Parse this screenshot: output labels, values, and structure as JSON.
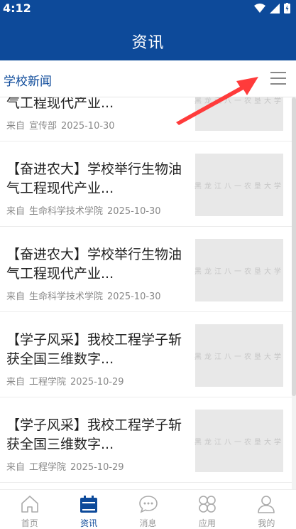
{
  "status": {
    "time": "4:12"
  },
  "header": {
    "title": "资讯"
  },
  "section": {
    "title": "学校新闻"
  },
  "news": [
    {
      "title": "【奋进农大】学校举行生物油气工程现代产业...",
      "source_prefix": "来自",
      "source": "宣传部",
      "date": "2025-10-30"
    },
    {
      "title": "【奋进农大】学校举行生物油气工程现代产业...",
      "source_prefix": "来自",
      "source": "生命科学技术学院",
      "date": "2025-10-30"
    },
    {
      "title": "【奋进农大】学校举行生物油气工程现代产业...",
      "source_prefix": "来自",
      "source": "生命科学技术学院",
      "date": "2025-10-30"
    },
    {
      "title": "【学子风采】我校工程学子斩获全国三维数字...",
      "source_prefix": "来自",
      "source": "工程学院",
      "date": "2025-10-29"
    },
    {
      "title": "【学子风采】我校工程学子斩获全国三维数字...",
      "source_prefix": "来自",
      "source": "工程学院",
      "date": "2025-10-29"
    }
  ],
  "thumb_watermark": "黑龙江八一农垦大学",
  "nav": [
    {
      "label": "首页",
      "icon": "home-icon"
    },
    {
      "label": "资讯",
      "icon": "calendar-icon"
    },
    {
      "label": "消息",
      "icon": "chat-icon"
    },
    {
      "label": "应用",
      "icon": "apps-icon"
    },
    {
      "label": "我的",
      "icon": "profile-icon"
    }
  ],
  "colors": {
    "brand": "#0d4a9a",
    "annotation_arrow": "#ff3b3b"
  }
}
